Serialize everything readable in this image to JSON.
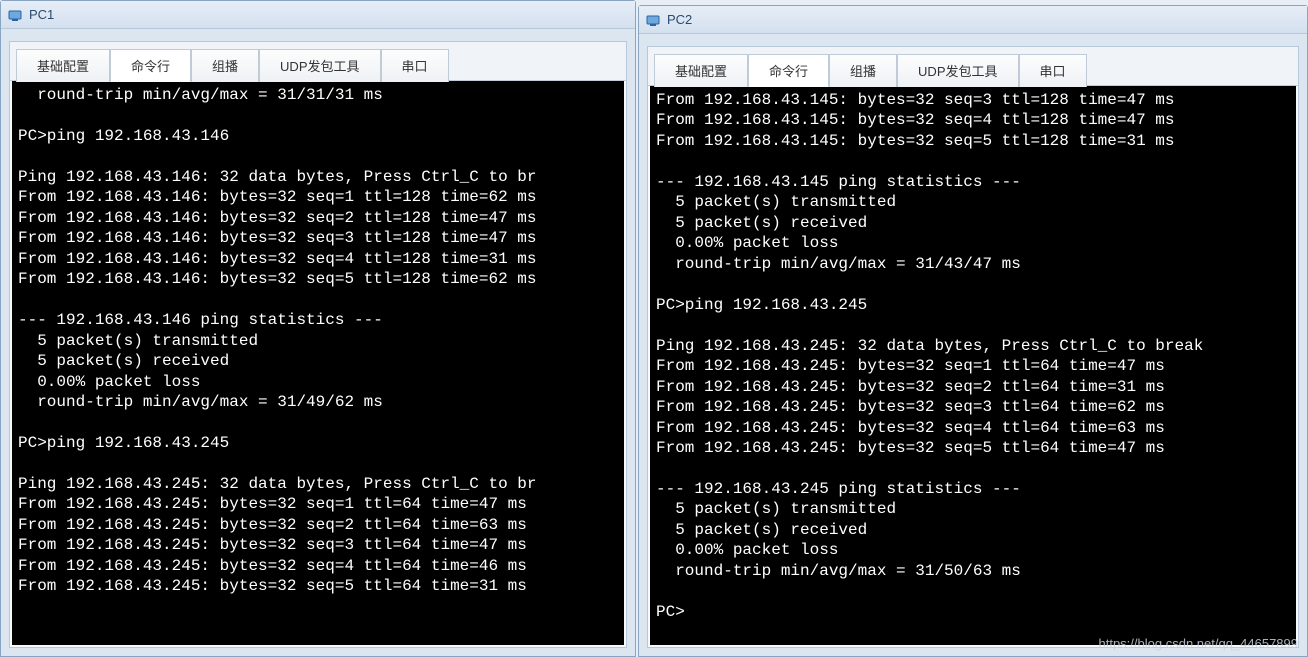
{
  "watermark": "https://blog.csdn.net/qq_44657899",
  "windows": {
    "pc1": {
      "title": "PC1",
      "tabs": [
        "基础配置",
        "命令行",
        "组播",
        "UDP发包工具",
        "串口"
      ],
      "active_tab_index": 1,
      "terminal_lines": [
        "  round-trip min/avg/max = 31/31/31 ms",
        "",
        "PC>ping 192.168.43.146",
        "",
        "Ping 192.168.43.146: 32 data bytes, Press Ctrl_C to br",
        "From 192.168.43.146: bytes=32 seq=1 ttl=128 time=62 ms",
        "From 192.168.43.146: bytes=32 seq=2 ttl=128 time=47 ms",
        "From 192.168.43.146: bytes=32 seq=3 ttl=128 time=47 ms",
        "From 192.168.43.146: bytes=32 seq=4 ttl=128 time=31 ms",
        "From 192.168.43.146: bytes=32 seq=5 ttl=128 time=62 ms",
        "",
        "--- 192.168.43.146 ping statistics ---",
        "  5 packet(s) transmitted",
        "  5 packet(s) received",
        "  0.00% packet loss",
        "  round-trip min/avg/max = 31/49/62 ms",
        "",
        "PC>ping 192.168.43.245",
        "",
        "Ping 192.168.43.245: 32 data bytes, Press Ctrl_C to br",
        "From 192.168.43.245: bytes=32 seq=1 ttl=64 time=47 ms",
        "From 192.168.43.245: bytes=32 seq=2 ttl=64 time=63 ms",
        "From 192.168.43.245: bytes=32 seq=3 ttl=64 time=47 ms",
        "From 192.168.43.245: bytes=32 seq=4 ttl=64 time=46 ms",
        "From 192.168.43.245: bytes=32 seq=5 ttl=64 time=31 ms",
        ""
      ]
    },
    "pc2": {
      "title": "PC2",
      "tabs": [
        "基础配置",
        "命令行",
        "组播",
        "UDP发包工具",
        "串口"
      ],
      "active_tab_index": 1,
      "terminal_lines": [
        "From 192.168.43.145: bytes=32 seq=3 ttl=128 time=47 ms",
        "From 192.168.43.145: bytes=32 seq=4 ttl=128 time=47 ms",
        "From 192.168.43.145: bytes=32 seq=5 ttl=128 time=31 ms",
        "",
        "--- 192.168.43.145 ping statistics ---",
        "  5 packet(s) transmitted",
        "  5 packet(s) received",
        "  0.00% packet loss",
        "  round-trip min/avg/max = 31/43/47 ms",
        "",
        "PC>ping 192.168.43.245",
        "",
        "Ping 192.168.43.245: 32 data bytes, Press Ctrl_C to break",
        "From 192.168.43.245: bytes=32 seq=1 ttl=64 time=47 ms",
        "From 192.168.43.245: bytes=32 seq=2 ttl=64 time=31 ms",
        "From 192.168.43.245: bytes=32 seq=3 ttl=64 time=62 ms",
        "From 192.168.43.245: bytes=32 seq=4 ttl=64 time=63 ms",
        "From 192.168.43.245: bytes=32 seq=5 ttl=64 time=47 ms",
        "",
        "--- 192.168.43.245 ping statistics ---",
        "  5 packet(s) transmitted",
        "  5 packet(s) received",
        "  0.00% packet loss",
        "  round-trip min/avg/max = 31/50/63 ms",
        "",
        "PC>"
      ]
    }
  }
}
